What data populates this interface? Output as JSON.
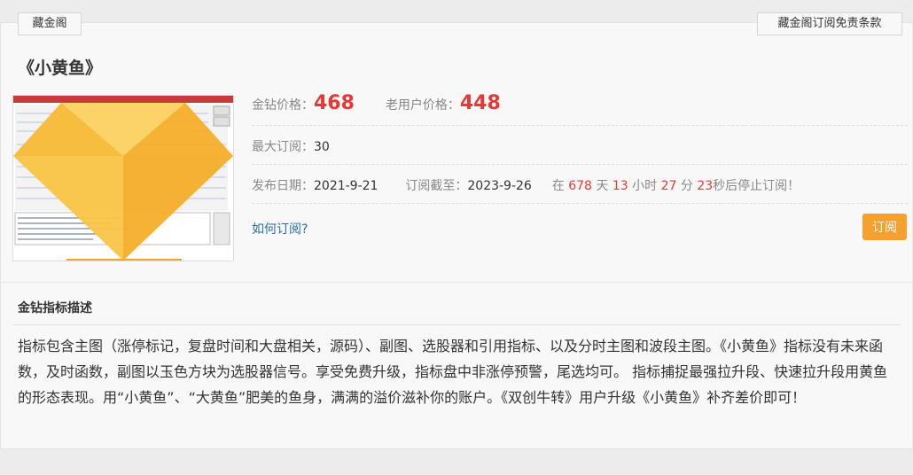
{
  "header": {
    "left_tag": "藏金阁",
    "right_tag": "藏金阁订阅免责条款"
  },
  "product": {
    "title": "《小黄鱼》",
    "price_label": "金钻价格：",
    "price": "468",
    "old_user_label": "老用户价格：",
    "old_user_price": "448",
    "max_sub_label": "最大订阅：",
    "max_sub": "30",
    "release_label": "发布日期：",
    "release_date": "2021-9-21",
    "deadline_label": "订阅截至：",
    "deadline": "2023-9-26",
    "countdown": {
      "prefix": "在",
      "days": "678",
      "days_unit": "天",
      "hours": "13",
      "hours_unit": "小时",
      "minutes": "27",
      "minutes_unit": "分",
      "seconds": "23",
      "suffix": "秒后停止订阅！"
    },
    "how_to_subscribe": "如何订阅?",
    "subscribe_button": "订阅"
  },
  "description": {
    "heading": "金钻指标描述",
    "body": "指标包含主图（涨停标记，复盘时间和大盘相关，源码）、副图、选股器和引用指标、以及分时主图和波段主图。《小黄鱼》指标没有未来函数，及时函数，副图以玉色方块为选股器信号。享受免费升级，指标盘中非涨停预警，尾选均可。 指标捕捉最强拉升段、快速拉升段用黄鱼的形态表现。用“小黄鱼”、“大黄鱼”肥美的鱼身，满满的溢价滋补你的账户。《双创牛转》用户升级《小黄鱼》补齐差价即可！"
  },
  "colors": {
    "accent_red": "#e53935",
    "button_orange": "#f6a02d",
    "link_blue": "#2b6cb0"
  }
}
